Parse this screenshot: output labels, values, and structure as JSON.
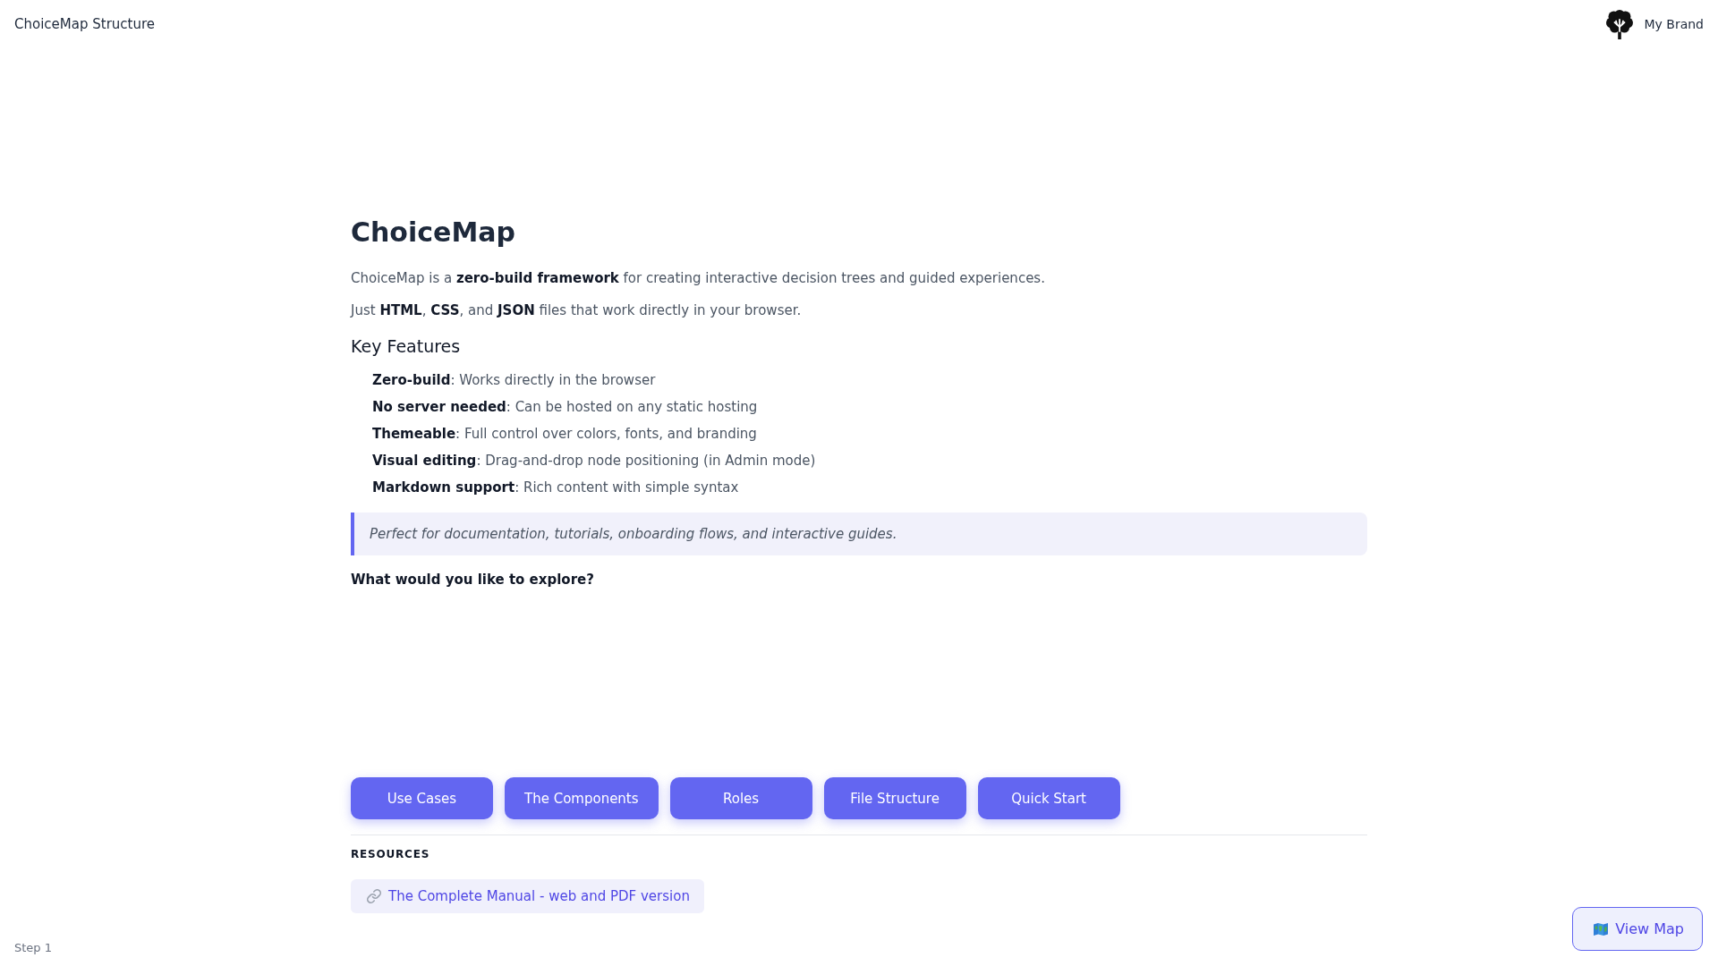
{
  "header": {
    "title": "ChoiceMap Structure",
    "brand": "My Brand"
  },
  "content": {
    "heading": "ChoiceMap",
    "paragraphs": [
      "ChoiceMap is a **zero-build framework** for creating interactive decision trees and guided experiences.",
      "Just **HTML**, **CSS**, and **JSON** files that work directly in your browser."
    ],
    "section_heading": "Key Features",
    "features": [
      "**Zero-build**: Works directly in the browser",
      "**No server needed**: Can be hosted on any static hosting",
      "**Themeable**: Full control over colors, fonts, and branding",
      "**Visual editing**: Drag-and-drop node positioning (in Admin mode)",
      "**Markdown support**: Rich content with simple syntax"
    ],
    "quote": "Perfect for documentation, tutorials, onboarding flows, and interactive guides.",
    "question": "What would you like to explore?"
  },
  "choices": [
    "Use Cases",
    "The Components",
    "Roles",
    "File Structure",
    "Quick Start"
  ],
  "resources": {
    "heading": "RESOURCES",
    "links": [
      "The Complete Manual - web and PDF version"
    ]
  },
  "footer": {
    "step": "Step 1",
    "view_map": "View Map"
  }
}
